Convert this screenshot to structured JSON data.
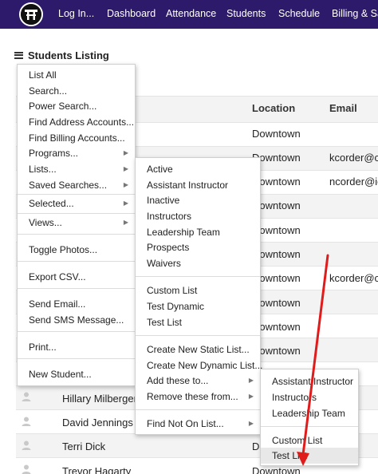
{
  "nav": {
    "items": [
      "Log In...",
      "Dashboard",
      "Attendance",
      "Students",
      "Schedule",
      "Billing & Sale"
    ]
  },
  "page": {
    "title": "Students Listing"
  },
  "table": {
    "headers": {
      "location": "Location",
      "email": "Email"
    },
    "rows": [
      {
        "name": "",
        "location": "Downtown",
        "email": ""
      },
      {
        "name": "",
        "location": "Downtown",
        "email": "kcorder@ce"
      },
      {
        "name": "",
        "location": "Downtown",
        "email": "ncorder@ic"
      },
      {
        "name": "",
        "location": "Downtown",
        "email": ""
      },
      {
        "name": "",
        "location": "Downtown",
        "email": ""
      },
      {
        "name": "",
        "location": "Downtown",
        "email": ""
      },
      {
        "name": "",
        "location": "Downtown",
        "email": "kcorder@ce"
      },
      {
        "name": "",
        "location": "Downtown",
        "email": ""
      },
      {
        "name": "",
        "location": "Downtown",
        "email": ""
      },
      {
        "name": "",
        "location": "Downtown",
        "email": ""
      },
      {
        "name": "Hillary Milberger",
        "location": "",
        "email": ""
      },
      {
        "name": "David Jennings",
        "location": "",
        "email": ""
      },
      {
        "name": "Terri Dick",
        "location": "Do",
        "email": ""
      },
      {
        "name": "Trevor Hagarty",
        "location": "Downtown",
        "email": ""
      }
    ]
  },
  "main_menu": {
    "items": [
      {
        "label": "List All"
      },
      {
        "label": "Search..."
      },
      {
        "label": "Power Search..."
      },
      {
        "label": "Find Address Accounts..."
      },
      {
        "label": "Find Billing Accounts..."
      },
      {
        "label": "Programs..."
      },
      {
        "label": "Lists..."
      },
      {
        "label": "Saved Searches..."
      },
      {
        "label": "Selected..."
      },
      {
        "label": "Views..."
      },
      {
        "label": "Toggle Photos..."
      },
      {
        "label": "Export CSV..."
      },
      {
        "label": "Send Email..."
      },
      {
        "label": "Send SMS Message..."
      },
      {
        "label": "Print..."
      },
      {
        "label": "New Student..."
      }
    ]
  },
  "lists_menu": {
    "items": [
      {
        "label": "Active"
      },
      {
        "label": "Assistant Instructor"
      },
      {
        "label": "Inactive"
      },
      {
        "label": "Instructors"
      },
      {
        "label": "Leadership Team"
      },
      {
        "label": "Prospects"
      },
      {
        "label": "Waivers"
      },
      {
        "label": "Custom List"
      },
      {
        "label": "Test Dynamic"
      },
      {
        "label": "Test List"
      },
      {
        "label": "Create New Static List..."
      },
      {
        "label": "Create New Dynamic List..."
      },
      {
        "label": "Add these to..."
      },
      {
        "label": "Remove these from..."
      },
      {
        "label": "Find Not On List..."
      }
    ]
  },
  "add_to_menu": {
    "items": [
      {
        "label": "Assistant Instructor"
      },
      {
        "label": "Instructors"
      },
      {
        "label": "Leadership Team"
      },
      {
        "label": "Custom List"
      },
      {
        "label": "Test List"
      }
    ]
  },
  "colors": {
    "nav_bg": "#2e1a6b",
    "annotation_arrow": "#e01b1b",
    "menu_hover": "#e8e8e8"
  },
  "icons": [
    "logo-emblem",
    "hamburger-icon",
    "submenu-arrow-icon",
    "avatar-icon"
  ]
}
